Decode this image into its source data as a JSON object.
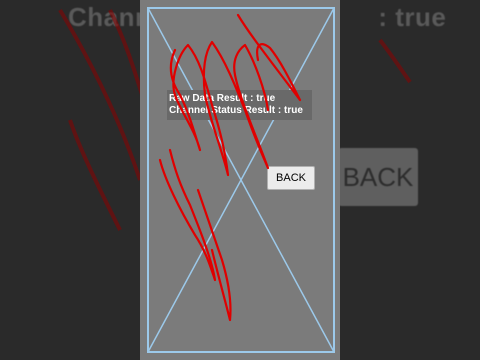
{
  "background": {
    "title_text": "Channe",
    "title_suffix_text": ": true",
    "back_label": "BACK"
  },
  "screen": {
    "results": {
      "raw_data": "Raw Data  Result : true",
      "channel_status": "Channel Status  Result : true"
    },
    "back_button": {
      "label": "BACK"
    }
  },
  "colors": {
    "screen_bg": "#7b7b7b",
    "frame_lines": "#9cc9ea",
    "scribble": "#e00000",
    "result_panel": "#696969",
    "text": "#ffffff"
  }
}
